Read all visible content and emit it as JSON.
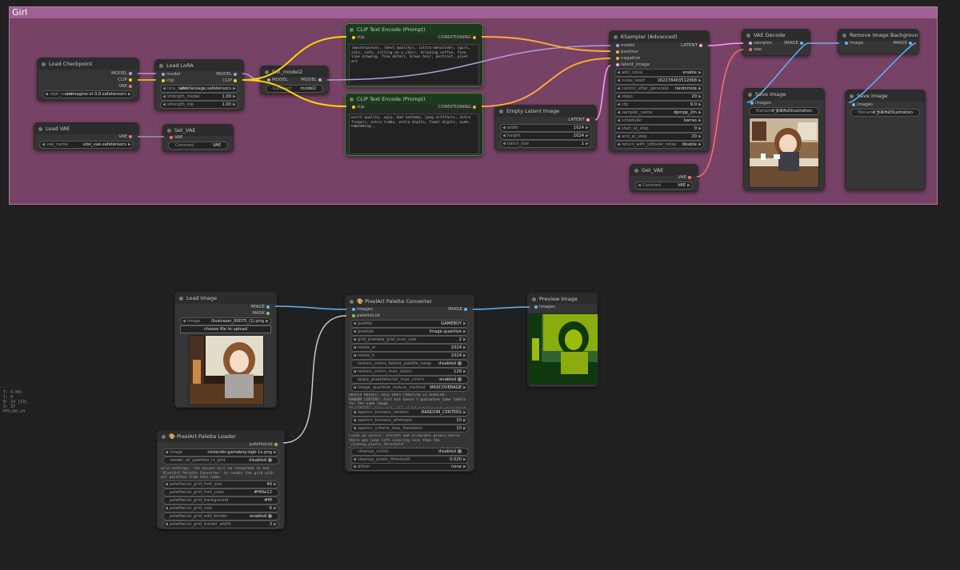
{
  "group": {
    "title": "Girl"
  },
  "stats": [
    "T: 0.00s",
    "I: 0",
    "N: 19 [19]",
    "V: 37",
    "FPS:60.24"
  ],
  "nodes": {
    "load_checkpoint": {
      "title": "Load Checkpoint",
      "outputs": [
        "MODEL",
        "CLIP",
        "VAE"
      ],
      "ckpt_label": "ckpt_name",
      "ckpt_value": "animagine-xl-3.0.safetensors"
    },
    "load_lora": {
      "title": "Load LoRA",
      "inputs": [
        "model",
        "clip"
      ],
      "outputs": [
        "MODEL",
        "CLIP"
      ],
      "widgets": [
        [
          "lora_name",
          "sdxl-faceage.safetensors"
        ],
        [
          "strength_model",
          "1.00"
        ],
        [
          "strength_clip",
          "1.00"
        ]
      ]
    },
    "set_model2": {
      "title": "Set_model2",
      "input": "MODEL",
      "output": "MODEL",
      "w_label": "Constant",
      "w_value": "model2"
    },
    "clip_pos": {
      "title": "CLIP Text Encode (Prompt)",
      "input": "clip",
      "output": "CONDITIONING",
      "text": "(masterpiece), (best quality), (ultra-detailed), 1girl, solo, cafe, sitting on a chair, drinking coffee, fine line drawing, fine detail, brown hair, portrait, pixel art"
    },
    "clip_neg": {
      "title": "CLIP Text Encode (Prompt)",
      "input": "clip",
      "output": "CONDITIONING",
      "text": "worst quality, ugly, bad anatomy, jpeg artifacts, extra fingers, extra limbs, extra digits, fewer digits, nude, embedding:,"
    },
    "load_vae": {
      "title": "Load VAE",
      "output": "VAE",
      "w_label": "vae_name",
      "w_value": "sdxl_vae.safetensors"
    },
    "set_vae": {
      "title": "Set_VAE",
      "input": "VAE",
      "w_label": "Constant",
      "w_value": "VAE"
    },
    "empty_latent": {
      "title": "Empty Latent Image",
      "output": "LATENT",
      "widgets": [
        [
          "width",
          "1024"
        ],
        [
          "height",
          "1024"
        ],
        [
          "batch_size",
          "1"
        ]
      ]
    },
    "ksampler": {
      "title": "KSampler (Advanced)",
      "inputs": [
        "model",
        "positive",
        "negative",
        "latent_image"
      ],
      "output": "LATENT",
      "widgets": [
        [
          "add_noise",
          "enable"
        ],
        [
          "noise_seed",
          "162278463512068"
        ],
        [
          "control_after_generate",
          "randomize"
        ],
        [
          "steps",
          "20"
        ],
        [
          "cfg",
          "9.0"
        ],
        [
          "sampler_name",
          "dpmpp_2m"
        ],
        [
          "scheduler",
          "karras"
        ],
        [
          "start_at_step",
          "0"
        ],
        [
          "end_at_step",
          "20"
        ],
        [
          "return_with_leftover_noise",
          "disable"
        ]
      ]
    },
    "get_vae": {
      "title": "Get_VAE",
      "output": "VAE",
      "w_label": "Constant",
      "w_value": "VAE"
    },
    "vae_decode": {
      "title": "VAE Decode",
      "inputs": [
        "samples",
        "vae"
      ],
      "output": "IMAGE"
    },
    "remove_bg": {
      "title": "Remove Image Background (abg)",
      "input": "image",
      "output": "IMAGE"
    },
    "save_image1": {
      "title": "Save Image",
      "input": "images",
      "w_label": "filename_prefix",
      "w_value": "イラスト2illustration"
    },
    "save_image2": {
      "title": "Save Image",
      "input": "images",
      "w_label": "filename_prefix",
      "w_value": "イラスト2illustration"
    },
    "load_image": {
      "title": "Load Image",
      "outputs": [
        "IMAGE",
        "MASK"
      ],
      "w_label": "image",
      "w_value": "illustraion_00075_(1).png",
      "upload": "choose file to upload"
    },
    "palette_converter": {
      "title": "🎨 PixelArt Palette Converter",
      "inputs": [
        "images",
        "paletteList"
      ],
      "output": "IMAGE",
      "widgets": [
        [
          "palette",
          "GAMEBOY"
        ],
        [
          "pixelize",
          "Image.quantize"
        ],
        [
          "grid_pixelate_grid_scan_size",
          "2"
        ],
        [
          "resize_w",
          "1024"
        ],
        [
          "resize_h",
          "1024"
        ],
        [
          "reduce_colors_before_palette_swap",
          "disabled"
        ],
        [
          "reduce_colors_max_colors",
          "128"
        ],
        [
          "apply_pixeldetector_max_colors",
          "enabled"
        ],
        [
          "image_quantize_reduce_method",
          "MAXCOVERAGE"
        ]
      ],
      "note1": "OpenCV kmeans: only when reducing is enabled.\nRANDOM_CENTERS: Fast but doesn't guarantee same labels for the same image.\nPP_CENTERS: Slow but will yield optimum and consistent results for same input.",
      "widgets2": [
        [
          "opencv_kmeans_centers",
          "RANDOM_CENTERS"
        ],
        [
          "opencv_kmeans_attempts",
          "10"
        ],
        [
          "opencv_criteria_max_iterations",
          "10"
        ]
      ],
      "note2": "Clean up colors: Iterate and eliminate pixels while there was none left covering less than the 'cleanup_pixels_threshold'.\nProcess: cleanup_pixels_threshold between (0.0~0.05)",
      "widgets3": [
        [
          "cleanup_colors",
          "disabled"
        ],
        [
          "cleanup_pixels_threshold",
          "0.020"
        ],
        [
          "dither",
          "none"
        ]
      ]
    },
    "preview_image": {
      "title": "Preview Image",
      "input": "images"
    },
    "palette_loader": {
      "title": "🎨 PixelArt Palette Loader",
      "output": "paletteList",
      "widgets": [
        [
          "image",
          "nintendo-gameboy-bgb-1x.png"
        ],
        [
          "render_all_palettes_in_grid",
          "disabled"
        ]
      ],
      "note": "Grid settings. The values will be forwarded to the 'PixelArt Palette Converter' to render the grid with all palettes from this node.",
      "widgets2": [
        [
          "paletteList_grid_font_size",
          "40"
        ],
        [
          "paletteList_grid_font_color",
          "#f40e12"
        ],
        [
          "paletteList_grid_background",
          "#fff"
        ],
        [
          "paletteList_grid_cols",
          "6"
        ],
        [
          "paletteList_grid_add_border",
          "enabled"
        ],
        [
          "paletteList_grid_border_width",
          "3"
        ]
      ]
    }
  },
  "colors": {
    "model": "#b39ddb",
    "clip": "#ffd500",
    "vae": "#ff6e6e",
    "conditioning": "#ffa931",
    "latent": "#ff9cf9",
    "image": "#64b5f6",
    "palette": "#8bc34a"
  }
}
